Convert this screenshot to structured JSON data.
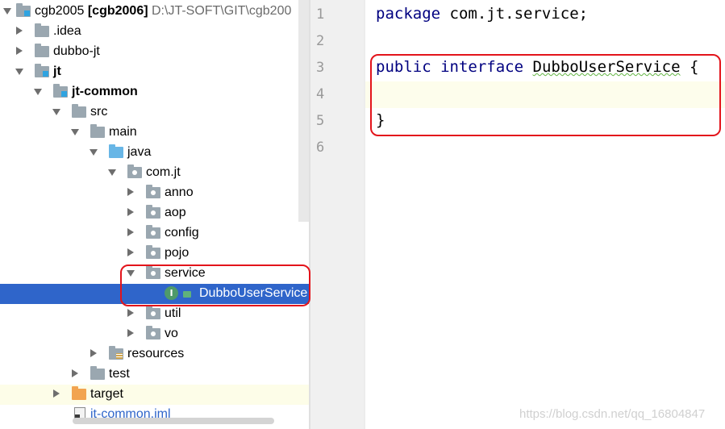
{
  "project_tree": {
    "root": {
      "name": "cgb2005",
      "module": "[cgb2006]",
      "path": "D:\\JT-SOFT\\GIT\\cgb200"
    },
    "items": [
      {
        "label": ".idea"
      },
      {
        "label": "dubbo-jt"
      },
      {
        "label": "jt"
      },
      {
        "label": "jt-common"
      },
      {
        "label": "src"
      },
      {
        "label": "main"
      },
      {
        "label": "java"
      },
      {
        "label": "com.jt"
      },
      {
        "label": "anno"
      },
      {
        "label": "aop"
      },
      {
        "label": "config"
      },
      {
        "label": "pojo"
      },
      {
        "label": "service"
      },
      {
        "label": "DubboUserService",
        "icon_letter": "I"
      },
      {
        "label": "util"
      },
      {
        "label": "vo"
      },
      {
        "label": "resources"
      },
      {
        "label": "test"
      },
      {
        "label": "target"
      },
      {
        "label": "jt-common.iml"
      }
    ]
  },
  "editor": {
    "line_numbers": [
      "1",
      "2",
      "3",
      "4",
      "5",
      "6"
    ],
    "code": {
      "line1_kw": "package",
      "line1_rest": " com.jt.service;",
      "line3_kw1": "public",
      "line3_kw2": "interface",
      "line3_name": "DubboUserService",
      "line3_brace": " {",
      "line5": "}"
    }
  },
  "watermark": "https://blog.csdn.net/qq_16804847",
  "colors": {
    "selection": "#2f65ca",
    "annotation_red": "#e3141b",
    "keyword": "#000080"
  }
}
